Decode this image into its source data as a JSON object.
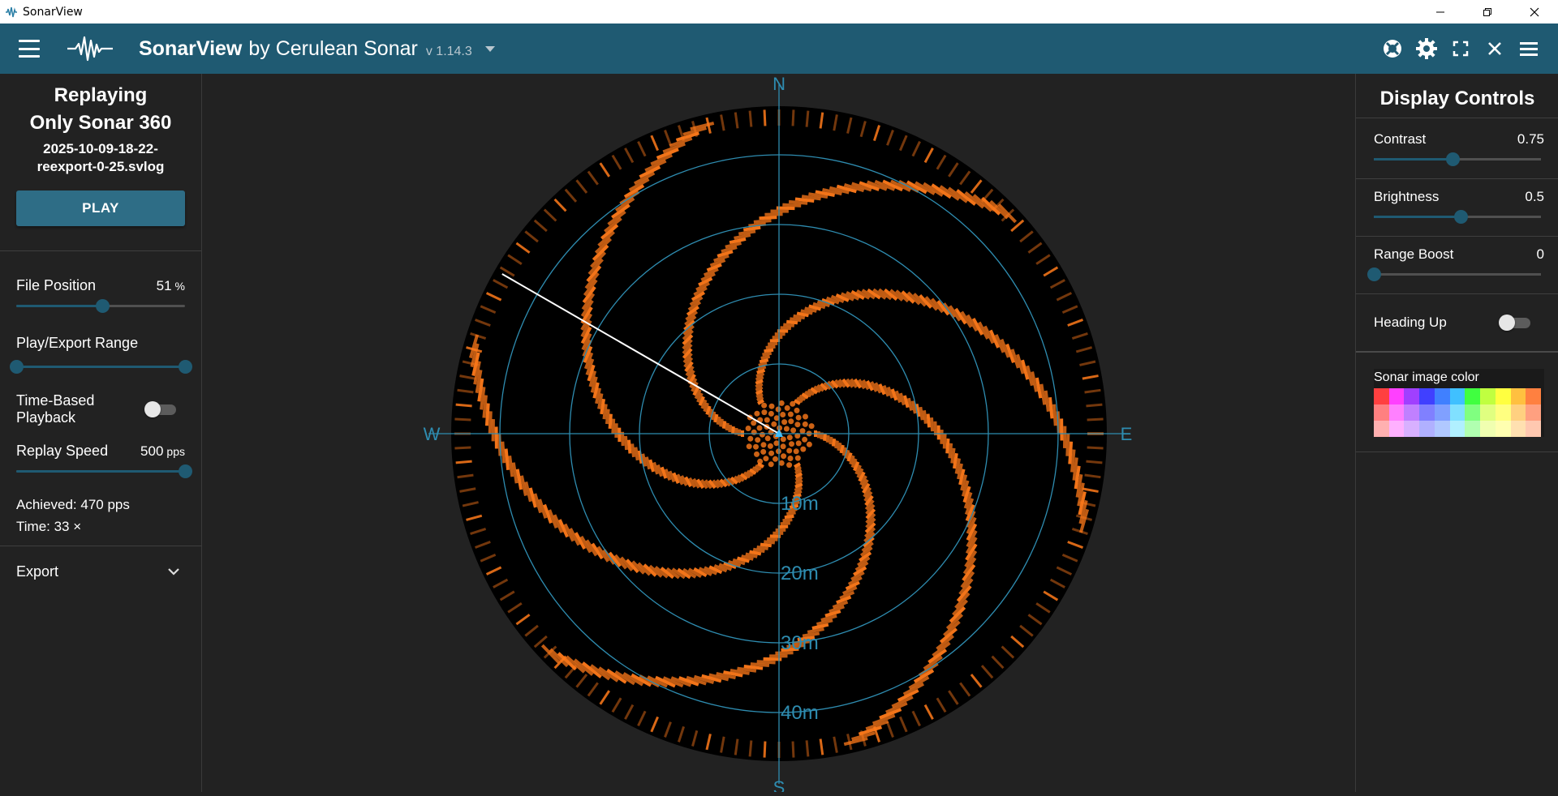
{
  "window": {
    "title": "SonarView",
    "controls": [
      "minimize",
      "restore",
      "close"
    ]
  },
  "header": {
    "brand_name": "SonarView",
    "brand_by": "by Cerulean Sonar",
    "version": "v 1.14.3",
    "icons": [
      "help-icon",
      "settings-gear-icon",
      "fullscreen-icon",
      "close-icon",
      "menu-icon"
    ]
  },
  "left_panel": {
    "title_line1": "Replaying",
    "title_line2": "Only Sonar 360",
    "file_line1": "2025-10-09-18-22-",
    "file_line2": "reexport-0-25.svlog",
    "play_label": "PLAY",
    "file_position": {
      "label": "File Position",
      "value": "51",
      "unit": "%",
      "fraction": 0.51
    },
    "play_export_range": {
      "label": "Play/Export Range",
      "start": 0.0,
      "end": 1.0
    },
    "time_based": {
      "label_line1": "Time-Based",
      "label_line2": "Playback",
      "on": false
    },
    "replay_speed": {
      "label": "Replay Speed",
      "value": "500",
      "unit": "pps",
      "fraction": 1.0
    },
    "achieved": "Achieved: 470 pps",
    "time": "Time: 33 ×",
    "export_label": "Export"
  },
  "sonar": {
    "compass": {
      "n": "N",
      "s": "S",
      "e": "E",
      "w": "W"
    },
    "range_labels": [
      "10m",
      "20m",
      "30m",
      "40m"
    ],
    "echo_color": "#ff7a1a",
    "grid_color": "#2e8cb0",
    "heading_deg": 300
  },
  "right_panel": {
    "title": "Display Controls",
    "contrast": {
      "label": "Contrast",
      "value": "0.75",
      "fraction": 0.47
    },
    "brightness": {
      "label": "Brightness",
      "value": "0.5",
      "fraction": 0.52
    },
    "range_boost": {
      "label": "Range Boost",
      "value": "0",
      "fraction": 0.0
    },
    "heading_up": {
      "label": "Heading Up",
      "on": false
    },
    "color_label": "Sonar image color",
    "swatch_rows": [
      [
        "#ff4040",
        "#ff40ff",
        "#a040ff",
        "#4040ff",
        "#4080ff",
        "#40c0ff",
        "#40ff40",
        "#c0ff40",
        "#ffff40",
        "#ffc040",
        "#ff8040"
      ],
      [
        "#ff8080",
        "#ff80ff",
        "#c080ff",
        "#8080ff",
        "#80a0ff",
        "#80e0ff",
        "#80ff80",
        "#e0ff80",
        "#ffff80",
        "#ffd080",
        "#ffa080"
      ],
      [
        "#ffb0b0",
        "#ffb0ff",
        "#d8b0ff",
        "#b0b0ff",
        "#b0c8ff",
        "#b0f0ff",
        "#b0ffb0",
        "#f0ffb0",
        "#ffffb0",
        "#ffe0b0",
        "#ffc8b0"
      ]
    ]
  }
}
